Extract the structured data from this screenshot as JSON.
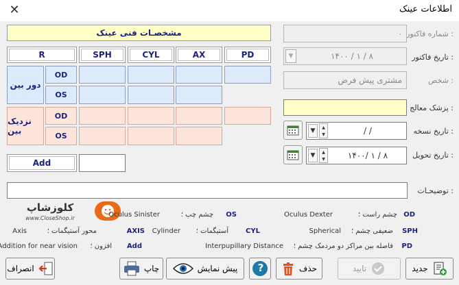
{
  "window": {
    "title": "اطلاعات عینک",
    "close_glyph": "✕"
  },
  "form": {
    "invoice_number": {
      "label": "شماره فاکتور :",
      "value": "۰"
    },
    "invoice_date": {
      "label": "تاریخ فاکتور :",
      "value": "۱۴۰۰ / ۱ / ۸"
    },
    "person": {
      "label": "شخص :",
      "value": "مشتری پیش فرض"
    },
    "doctor": {
      "label": "پزشک معالج :",
      "value": ""
    },
    "prescription_date": {
      "label": "تاریخ نسخه :",
      "value": "/     /"
    },
    "delivery_date": {
      "label": "تاریخ تحویل :",
      "value": "۱۴۰۰/ ۱ / ۸"
    },
    "notes": {
      "label": "توضیحـات :",
      "value": ""
    }
  },
  "specs": {
    "title": "مشخصـات فنی عینک",
    "columns": [
      "PD",
      "AX",
      "CYL",
      "SPH",
      "R"
    ],
    "rows": [
      {
        "label": "دور بین",
        "eyes": [
          "OD",
          "OS"
        ]
      },
      {
        "label": "نزدیک بین",
        "eyes": [
          "OD",
          "OS"
        ]
      }
    ],
    "add_label": "Add",
    "add_value": ""
  },
  "brand": {
    "name": "کلوزشاپ",
    "url": "www.CloseShop.ir"
  },
  "legend": [
    {
      "code": "OD",
      "fa": "چشم راست ؛",
      "en": "Oculus Dexter"
    },
    {
      "code": "OS",
      "fa": "چشم چپ ؛",
      "en": "Oculus Sinister"
    },
    {
      "code": "SPH",
      "fa": "ضعیفی چشم ؛",
      "en": "Spherical"
    },
    {
      "code": "CYL",
      "fa": "آستیگمات ؛",
      "en": "Cylinder"
    },
    {
      "code": "AXIS",
      "fa": "محور آستیگمات ؛",
      "en": "Axis"
    },
    {
      "code": "PD",
      "fa": "فاصله بین مراکز دو مردمک چشم ؛",
      "en": "Interpupillary Distance"
    },
    {
      "code": "Add",
      "fa": "افزون ؛",
      "en": "Addition for near vision"
    }
  ],
  "buttons": {
    "new": "جدید",
    "confirm": "تایید",
    "delete": "حذف",
    "help": "?",
    "preview": "پیش نمایش",
    "print": "چاپ",
    "cancel": "انصراف"
  },
  "colors": {
    "blue_cells": "#ddeafc",
    "pink_cells": "#fde5dc",
    "yellow_field": "#ffffc8",
    "label_blue": "#1a237e"
  }
}
